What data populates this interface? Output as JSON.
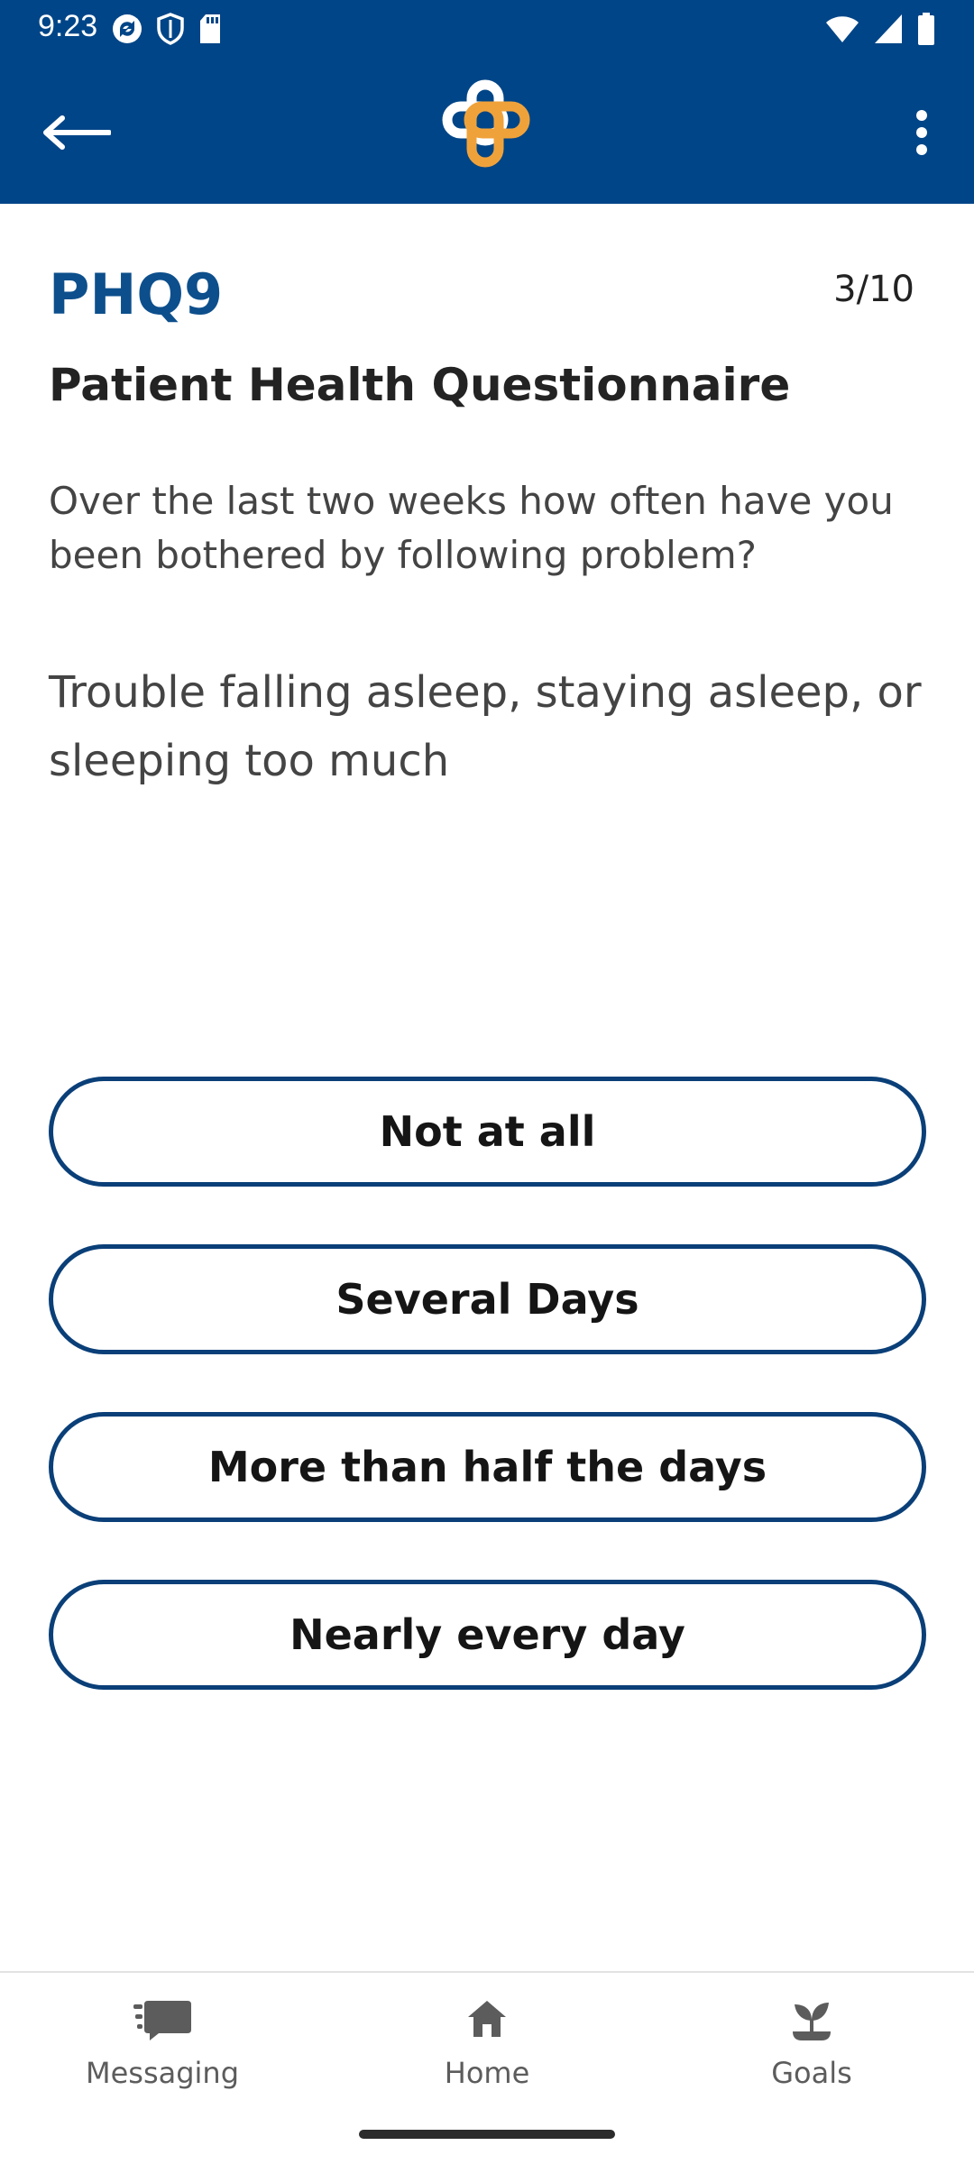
{
  "status_bar": {
    "time": "9:23",
    "left_icons": [
      "sync-icon",
      "shield-icon",
      "sd-card-icon"
    ],
    "right_icons": [
      "wifi-icon",
      "signal-icon",
      "battery-icon"
    ]
  },
  "app_bar": {
    "back_icon": "arrow-left-icon",
    "logo": "health-cross-logo",
    "menu_icon": "more-vert-icon",
    "colors": {
      "background": "#004587",
      "logo_white": "#ffffff",
      "logo_orange": "#F0A23A"
    }
  },
  "questionnaire": {
    "code": "PHQ9",
    "progress": "3/10",
    "name": "Patient Health Questionnaire",
    "prompt": "Over the last two weeks how often have you been bothered by following problem?",
    "question": "Trouble falling asleep, staying asleep, or sleeping too much",
    "options": [
      {
        "label": "Not at all"
      },
      {
        "label": "Several Days"
      },
      {
        "label": "More than half the days"
      },
      {
        "label": "Nearly every day"
      }
    ]
  },
  "bottom_nav": {
    "items": [
      {
        "label": "Messaging",
        "icon": "chat-icon"
      },
      {
        "label": "Home",
        "icon": "home-icon"
      },
      {
        "label": "Goals",
        "icon": "sprout-icon"
      }
    ]
  }
}
